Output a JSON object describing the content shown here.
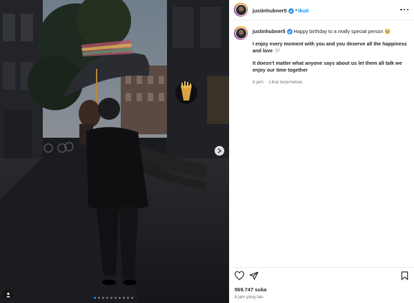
{
  "post": {
    "username": "justinhubner5",
    "separator": "•",
    "follow_label": "Ikuti",
    "more_icon": "more-options-icon",
    "photo_alt": "Couple walking under an umbrella on a wet street at dusk",
    "carousel": {
      "count": 10,
      "active_index": 0
    }
  },
  "caption": {
    "username": "justinhubner5",
    "line1": "Happy birthday to a really special person 🥹",
    "para1": "I enjoy every moment with you and you deserve all the happiness and love 🤍",
    "para2": "It doesn't matter what anyone says about us let them all talk we enjoy our time together",
    "time": "8 jam",
    "translate_label": "Lihat terjemahan"
  },
  "footer": {
    "likes": "569.747 suka",
    "posted": "8 jam yang lalu"
  },
  "colors": {
    "link": "#0095f6",
    "verified": "#3897f0",
    "text": "#262626",
    "muted": "#737373"
  }
}
